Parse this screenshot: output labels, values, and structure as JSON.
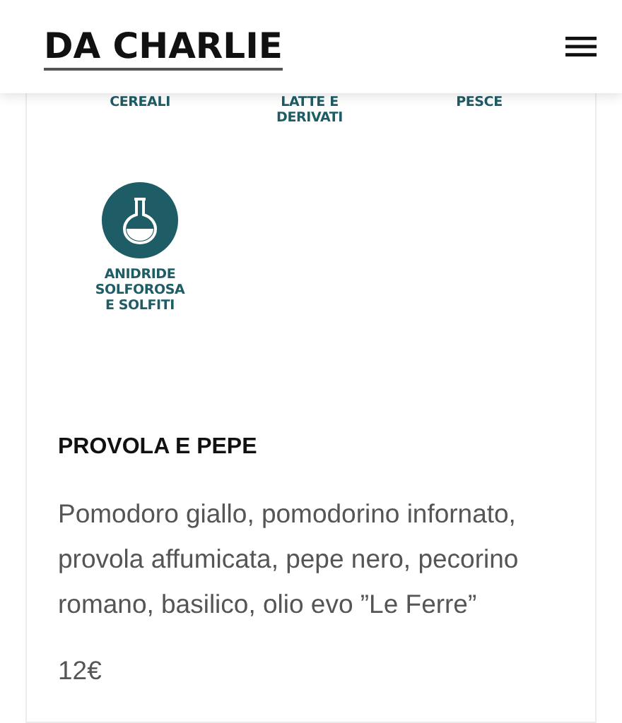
{
  "header": {
    "logo": "DA CHARLIE"
  },
  "allergens": [
    {
      "label": "CEREALI",
      "kind": "label-only"
    },
    {
      "label": "LATTE E DERIVATI",
      "kind": "label-only"
    },
    {
      "label": "PESCE",
      "kind": "label-only"
    },
    {
      "label": "ANIDRIDE SOLFOROSA E SOLFITI",
      "kind": "icon"
    }
  ],
  "dish": {
    "name": "PROVOLA E PEPE",
    "description": "Pomodoro giallo, pomodorino infornato, provola affumicata, pepe nero, pecorino romano, basilico, olio evo ”Le Ferre”",
    "price": "12€"
  }
}
